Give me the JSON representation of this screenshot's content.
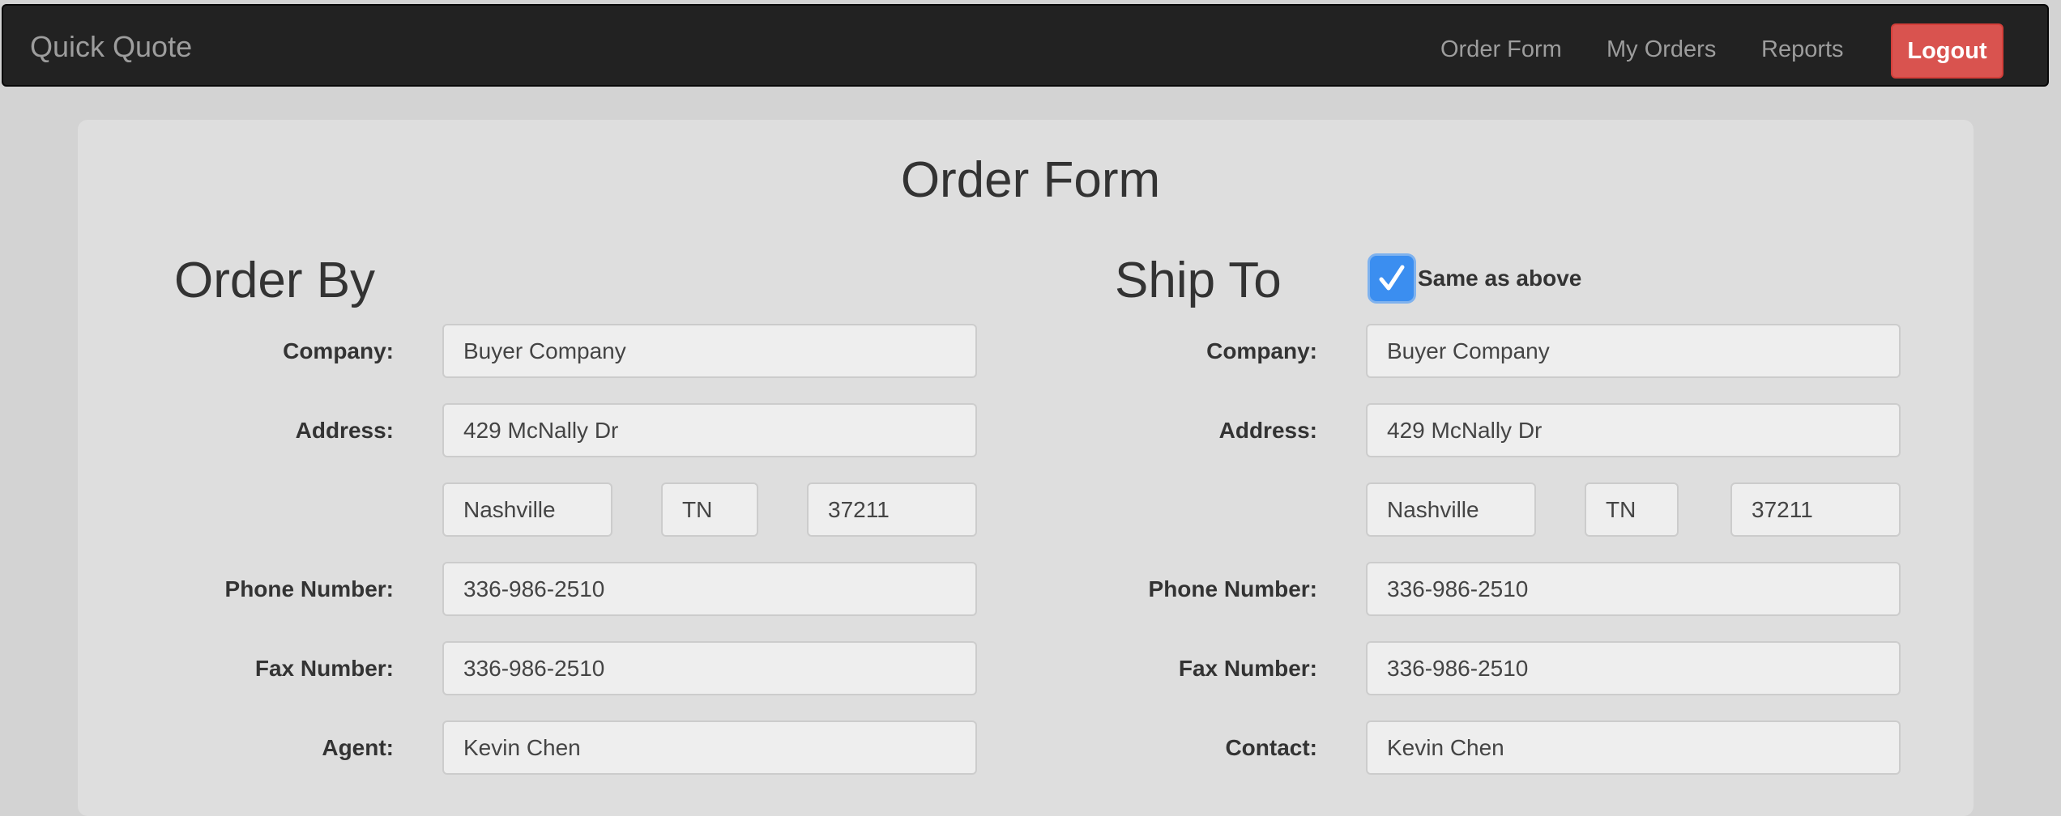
{
  "navbar": {
    "brand": "Quick Quote",
    "links": [
      "Order Form",
      "My Orders",
      "Reports"
    ],
    "logout_label": "Logout"
  },
  "page": {
    "title": "Order Form"
  },
  "order_by": {
    "heading": "Order By",
    "labels": {
      "company": "Company:",
      "address": "Address:",
      "phone": "Phone Number:",
      "fax": "Fax Number:",
      "agent": "Agent:"
    },
    "values": {
      "company": "Buyer Company",
      "address": "429 McNally Dr",
      "city": "Nashville",
      "state": "TN",
      "zip": "37211",
      "phone": "336-986-2510",
      "fax": "336-986-2510",
      "agent": "Kevin Chen"
    }
  },
  "ship_to": {
    "heading": "Ship To",
    "same_as_above_label": "Same as above",
    "same_as_above_checked": true,
    "labels": {
      "company": "Company:",
      "address": "Address:",
      "phone": "Phone Number:",
      "fax": "Fax Number:",
      "contact": "Contact:"
    },
    "values": {
      "company": "Buyer Company",
      "address": "429 McNally Dr",
      "city": "Nashville",
      "state": "TN",
      "zip": "37211",
      "phone": "336-986-2510",
      "fax": "336-986-2510",
      "contact": "Kevin Chen"
    }
  },
  "colors": {
    "navbar_bg": "#222222",
    "logout_bg": "#d9534f",
    "checkbox_accent": "#3b8ef0"
  }
}
